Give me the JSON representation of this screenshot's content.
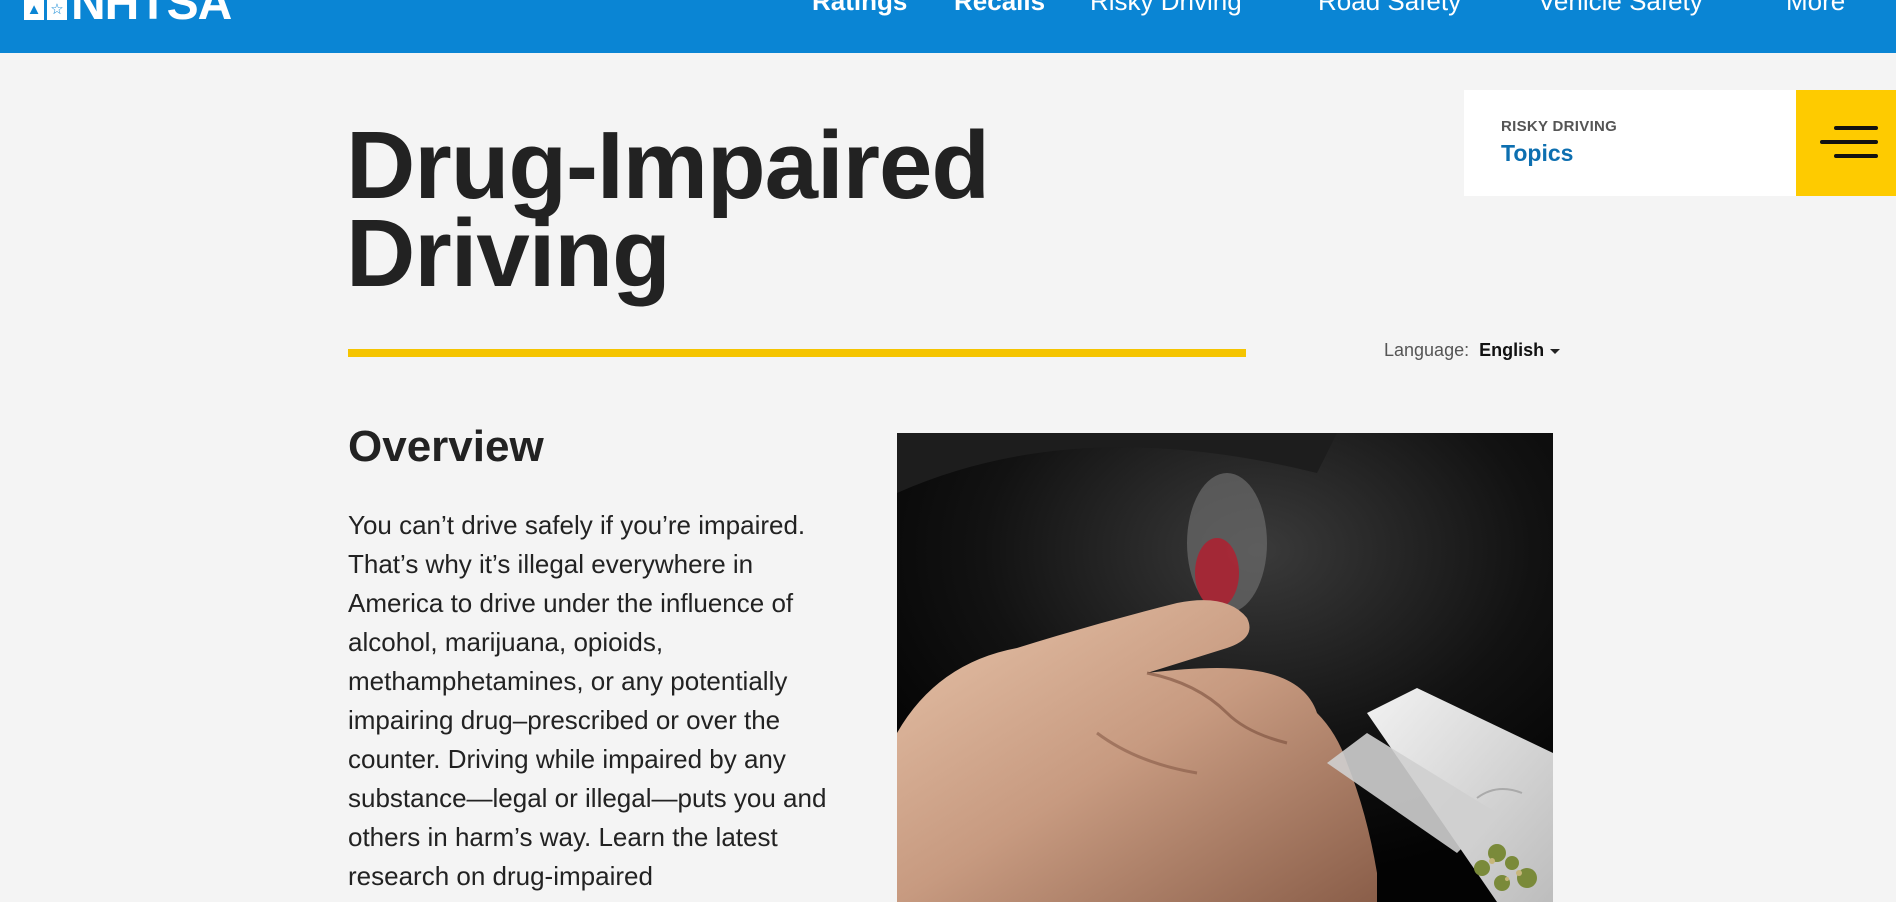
{
  "header": {
    "logo_text": "NHTSA",
    "nav": [
      {
        "label": "Ratings"
      },
      {
        "label": "Recalls"
      },
      {
        "label": "Risky Driving"
      },
      {
        "label": "Road Safety"
      },
      {
        "label": "Vehicle Safety"
      },
      {
        "label": "More"
      }
    ]
  },
  "page": {
    "title": "Drug-Impaired Driving"
  },
  "topics": {
    "eyebrow": "RISKY DRIVING",
    "link": "Topics",
    "menu_icon": "hamburger-menu-icon"
  },
  "language": {
    "label": "Language:",
    "value": "English"
  },
  "overview": {
    "heading": "Overview",
    "body": "You can’t drive safely if you’re impaired. That’s why it’s illegal everywhere in America to drive under the influence of alcohol, marijuana, opioids, methamphetamines, or any potentially impairing drug–prescribed or over the counter. Driving while impaired by any substance—legal or illegal—puts you and others in harm’s way. Learn the latest research on drug-impaired"
  },
  "colors": {
    "header_blue": "#0a85d4",
    "accent_yellow": "#f5c400",
    "menu_yellow": "#fecb00",
    "link_blue": "#0d6fb0",
    "background": "#f4f4f4"
  }
}
